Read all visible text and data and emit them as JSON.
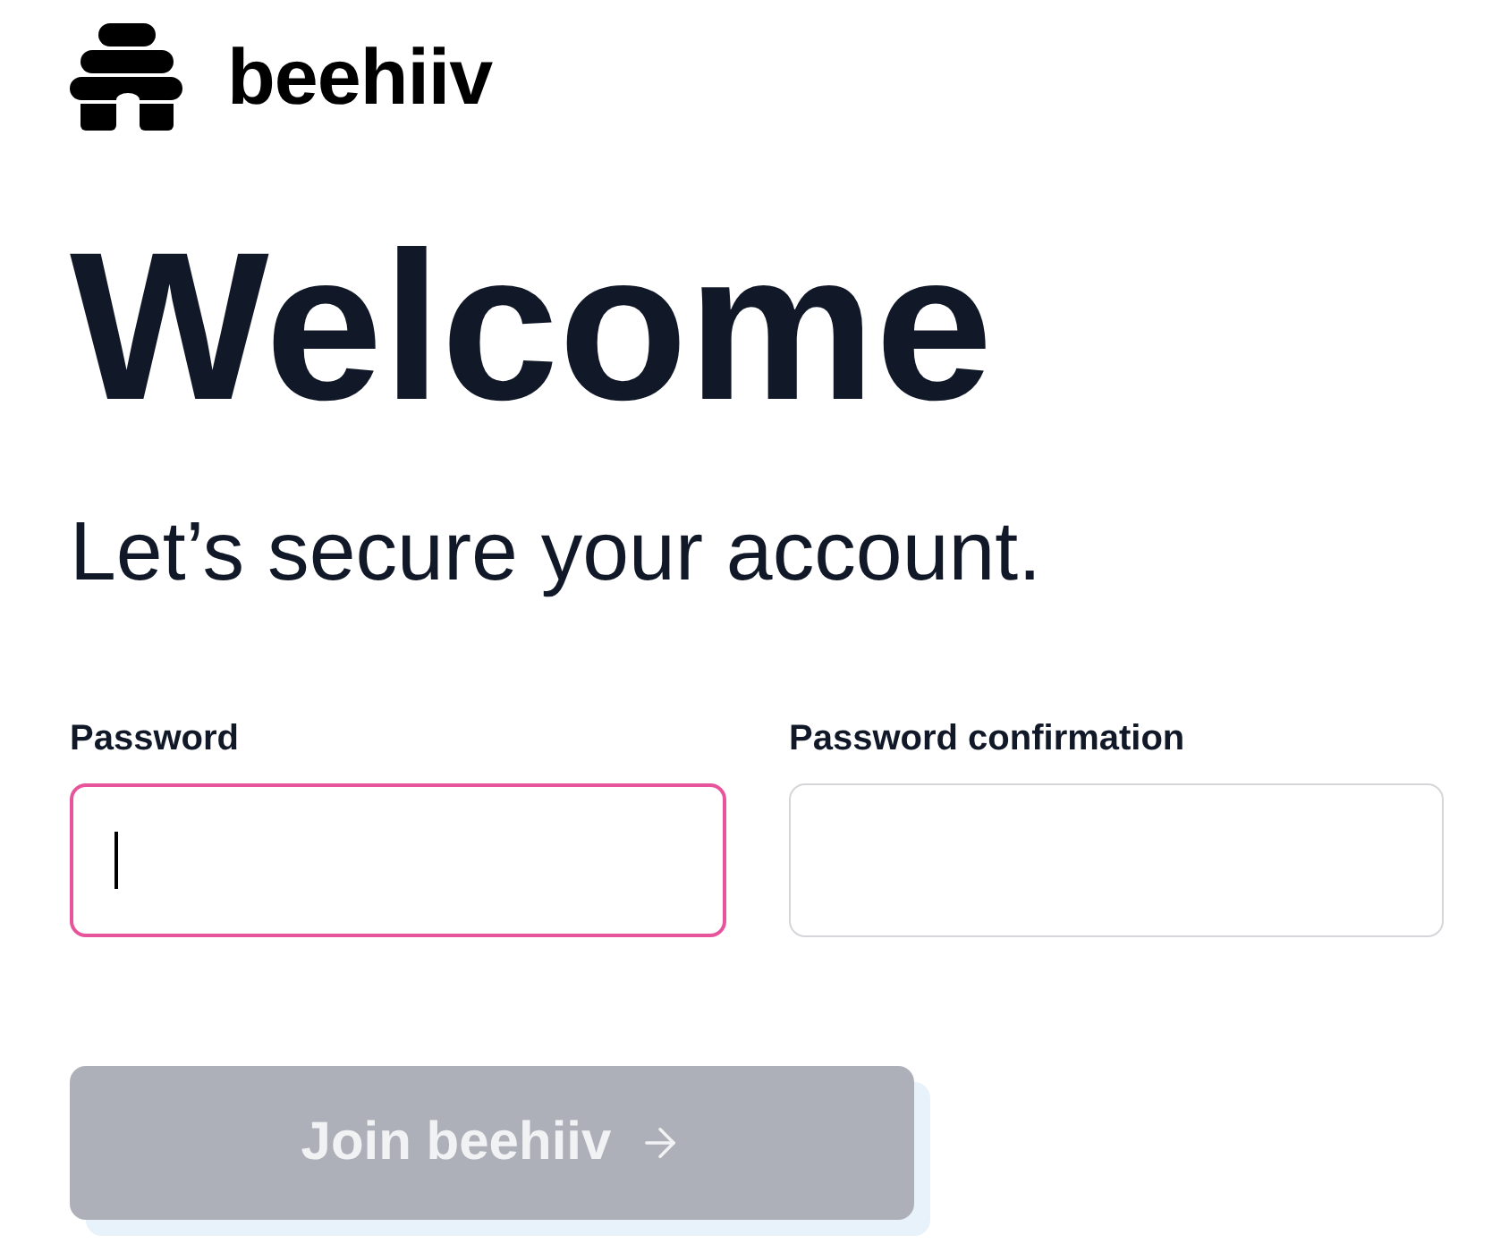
{
  "logo": {
    "text": "beehiiv"
  },
  "heading": "Welcome",
  "subtitle": "Let’s secure your account.",
  "fields": [
    {
      "label": "Password",
      "focused": true
    },
    {
      "label": "Password confirmation",
      "focused": false
    }
  ],
  "submit_button": {
    "label": "Join beehiiv",
    "disabled": true
  }
}
